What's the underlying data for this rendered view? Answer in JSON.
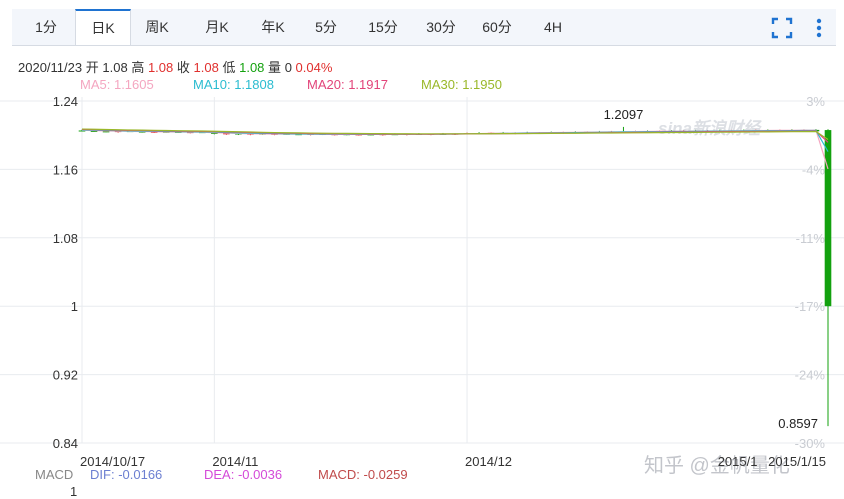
{
  "tabs": [
    {
      "label": "1分",
      "active": false
    },
    {
      "label": "日K",
      "active": true
    },
    {
      "label": "周K",
      "active": false
    },
    {
      "label": "月K",
      "active": false
    },
    {
      "label": "年K",
      "active": false
    },
    {
      "label": "5分",
      "active": false
    },
    {
      "label": "15分",
      "active": false
    },
    {
      "label": "30分",
      "active": false
    },
    {
      "label": "60分",
      "active": false
    },
    {
      "label": "4H",
      "active": false
    }
  ],
  "toolbar": {
    "fullscreen_icon": "fullscreen-icon",
    "more_icon": "vertical-dots-icon"
  },
  "info": {
    "date": "2020/11/23",
    "open_label": "开",
    "open": "1.08",
    "high_label": "高",
    "high": "1.08",
    "close_label": "收",
    "close": "1.08",
    "low_label": "低",
    "low": "1.08",
    "volume_label": "量",
    "volume": "0",
    "change": "0.04%"
  },
  "ma": [
    {
      "label": "MA5:",
      "value": "1.1605",
      "color": "#f4a6c0"
    },
    {
      "label": "MA10:",
      "value": "1.1808",
      "color": "#2bbcd0"
    },
    {
      "label": "MA20:",
      "value": "1.1917",
      "color": "#e2447a"
    },
    {
      "label": "MA30:",
      "value": "1.1950",
      "color": "#9ab82a"
    }
  ],
  "macd": {
    "title": "MACD",
    "dif_label": "DIF:",
    "dif": "-0.0166",
    "dif_color": "#6c7fd1",
    "dea_label": "DEA:",
    "dea": "-0.0036",
    "dea_color": "#d44ad8",
    "macd_label": "MACD:",
    "macd": "-0.0259",
    "macd_color": "#c04b4b",
    "axis_top": "1"
  },
  "colors": {
    "up": "#e0302e",
    "down": "#13a10e",
    "grid": "#e8ebef",
    "accent": "#1f73d1"
  },
  "watermark": {
    "logo": "sina新浪财经",
    "credit": "知乎 @金帆量化"
  },
  "chart_data": {
    "type": "candlestick",
    "ylim": [
      0.84,
      1.24
    ],
    "y_ticks": [
      "1.24",
      "1.16",
      "1.08",
      "1",
      "0.92",
      "0.84"
    ],
    "y_tick_values": [
      1.24,
      1.16,
      1.08,
      1.0,
      0.92,
      0.84
    ],
    "pct_ticks": [
      "3%",
      "-4%",
      "-11%",
      "-17%",
      "-24%",
      "-30%"
    ],
    "x_ticks": [
      {
        "label": "2014/10/17",
        "index": 0
      },
      {
        "label": "2014/11",
        "index": 11
      },
      {
        "label": "2014/12",
        "index": 32
      },
      {
        "label": "2015/1",
        "index": 53
      },
      {
        "label": "2015/1/15",
        "index": 61
      }
    ],
    "annotations": [
      {
        "text": "1.2097",
        "index": 45,
        "value": 1.2097
      },
      {
        "text": "0.8597",
        "index": 62,
        "value": 0.8597
      }
    ],
    "candles": [
      {
        "o": 1.2055,
        "h": 1.2065,
        "l": 1.2045,
        "c": 1.205
      },
      {
        "o": 1.205,
        "h": 1.206,
        "l": 1.204,
        "c": 1.2045
      },
      {
        "o": 1.2045,
        "h": 1.2055,
        "l": 1.2035,
        "c": 1.204
      },
      {
        "o": 1.204,
        "h": 1.2052,
        "l": 1.203,
        "c": 1.2048
      },
      {
        "o": 1.2048,
        "h": 1.2058,
        "l": 1.2038,
        "c": 1.2042
      },
      {
        "o": 1.2042,
        "h": 1.205,
        "l": 1.203,
        "c": 1.2035
      },
      {
        "o": 1.2035,
        "h": 1.2046,
        "l": 1.2026,
        "c": 1.204
      },
      {
        "o": 1.204,
        "h": 1.205,
        "l": 1.203,
        "c": 1.2038
      },
      {
        "o": 1.2038,
        "h": 1.2048,
        "l": 1.2028,
        "c": 1.2032
      },
      {
        "o": 1.2032,
        "h": 1.2042,
        "l": 1.2022,
        "c": 1.2036
      },
      {
        "o": 1.2036,
        "h": 1.2046,
        "l": 1.2026,
        "c": 1.203
      },
      {
        "o": 1.203,
        "h": 1.204,
        "l": 1.201,
        "c": 1.2015
      },
      {
        "o": 1.2015,
        "h": 1.2028,
        "l": 1.2005,
        "c": 1.2022
      },
      {
        "o": 1.2022,
        "h": 1.2032,
        "l": 1.2002,
        "c": 1.2008
      },
      {
        "o": 1.2008,
        "h": 1.202,
        "l": 1.2,
        "c": 1.2018
      },
      {
        "o": 1.2018,
        "h": 1.2028,
        "l": 1.2005,
        "c": 1.201
      },
      {
        "o": 1.201,
        "h": 1.2022,
        "l": 1.2,
        "c": 1.2016
      },
      {
        "o": 1.2016,
        "h": 1.2026,
        "l": 1.2006,
        "c": 1.2012
      },
      {
        "o": 1.2012,
        "h": 1.2022,
        "l": 1.2002,
        "c": 1.2006
      },
      {
        "o": 1.2006,
        "h": 1.2018,
        "l": 1.1998,
        "c": 1.2014
      },
      {
        "o": 1.2014,
        "h": 1.2024,
        "l": 1.2002,
        "c": 1.2008
      },
      {
        "o": 1.2008,
        "h": 1.2018,
        "l": 1.1998,
        "c": 1.2012
      },
      {
        "o": 1.2012,
        "h": 1.2022,
        "l": 1.2,
        "c": 1.2004
      },
      {
        "o": 1.2004,
        "h": 1.2016,
        "l": 1.1996,
        "c": 1.201
      },
      {
        "o": 1.201,
        "h": 1.202,
        "l": 1.2,
        "c": 1.2006
      },
      {
        "o": 1.2006,
        "h": 1.2016,
        "l": 1.1996,
        "c": 1.2012
      },
      {
        "o": 1.2012,
        "h": 1.2022,
        "l": 1.2002,
        "c": 1.2008
      },
      {
        "o": 1.2008,
        "h": 1.2018,
        "l": 1.1998,
        "c": 1.2014
      },
      {
        "o": 1.2014,
        "h": 1.2024,
        "l": 1.2004,
        "c": 1.201
      },
      {
        "o": 1.201,
        "h": 1.202,
        "l": 1.2,
        "c": 1.2016
      },
      {
        "o": 1.2016,
        "h": 1.2026,
        "l": 1.2006,
        "c": 1.2012
      },
      {
        "o": 1.2012,
        "h": 1.2022,
        "l": 1.2002,
        "c": 1.2018
      },
      {
        "o": 1.2018,
        "h": 1.203,
        "l": 1.2008,
        "c": 1.2025
      },
      {
        "o": 1.2025,
        "h": 1.2035,
        "l": 1.2015,
        "c": 1.202
      },
      {
        "o": 1.202,
        "h": 1.2032,
        "l": 1.201,
        "c": 1.2028
      },
      {
        "o": 1.2028,
        "h": 1.2038,
        "l": 1.2018,
        "c": 1.2022
      },
      {
        "o": 1.2022,
        "h": 1.2034,
        "l": 1.2012,
        "c": 1.203
      },
      {
        "o": 1.203,
        "h": 1.204,
        "l": 1.202,
        "c": 1.2026
      },
      {
        "o": 1.2026,
        "h": 1.2036,
        "l": 1.2016,
        "c": 1.2032
      },
      {
        "o": 1.2032,
        "h": 1.2042,
        "l": 1.2022,
        "c": 1.2028
      },
      {
        "o": 1.2028,
        "h": 1.204,
        "l": 1.2018,
        "c": 1.2036
      },
      {
        "o": 1.2036,
        "h": 1.2046,
        "l": 1.2026,
        "c": 1.2032
      },
      {
        "o": 1.2032,
        "h": 1.2044,
        "l": 1.2022,
        "c": 1.204
      },
      {
        "o": 1.204,
        "h": 1.205,
        "l": 1.203,
        "c": 1.2036
      },
      {
        "o": 1.2036,
        "h": 1.205,
        "l": 1.2026,
        "c": 1.2044
      },
      {
        "o": 1.2044,
        "h": 1.2097,
        "l": 1.203,
        "c": 1.204
      },
      {
        "o": 1.204,
        "h": 1.2052,
        "l": 1.203,
        "c": 1.2046
      },
      {
        "o": 1.2046,
        "h": 1.2056,
        "l": 1.2036,
        "c": 1.2042
      },
      {
        "o": 1.2042,
        "h": 1.2054,
        "l": 1.2032,
        "c": 1.205
      },
      {
        "o": 1.205,
        "h": 1.206,
        "l": 1.204,
        "c": 1.2046
      },
      {
        "o": 1.2046,
        "h": 1.2058,
        "l": 1.2036,
        "c": 1.2052
      },
      {
        "o": 1.2052,
        "h": 1.2062,
        "l": 1.2042,
        "c": 1.2048
      },
      {
        "o": 1.2048,
        "h": 1.206,
        "l": 1.2038,
        "c": 1.2054
      },
      {
        "o": 1.2054,
        "h": 1.2064,
        "l": 1.2044,
        "c": 1.205
      },
      {
        "o": 1.205,
        "h": 1.2062,
        "l": 1.204,
        "c": 1.2056
      },
      {
        "o": 1.2056,
        "h": 1.2066,
        "l": 1.2046,
        "c": 1.2052
      },
      {
        "o": 1.2052,
        "h": 1.2064,
        "l": 1.2042,
        "c": 1.2058
      },
      {
        "o": 1.2058,
        "h": 1.2068,
        "l": 1.2048,
        "c": 1.2054
      },
      {
        "o": 1.2054,
        "h": 1.2066,
        "l": 1.2044,
        "c": 1.206
      },
      {
        "o": 1.206,
        "h": 1.207,
        "l": 1.205,
        "c": 1.2056
      },
      {
        "o": 1.2056,
        "h": 1.2068,
        "l": 1.2046,
        "c": 1.2062
      },
      {
        "o": 1.2062,
        "h": 1.2072,
        "l": 1.204,
        "c": 1.2045
      },
      {
        "o": 1.206,
        "h": 1.207,
        "l": 0.8597,
        "c": 1.0
      }
    ],
    "series": [
      {
        "name": "MA5",
        "values": [
          1.2058,
          1.2054,
          1.205,
          1.2047,
          1.2045,
          1.2043,
          1.2041,
          1.2039,
          1.2037,
          1.2036,
          1.2034,
          1.203,
          1.2025,
          1.202,
          1.2017,
          1.2015,
          1.2014,
          1.2013,
          1.2012,
          1.2011,
          1.2011,
          1.201,
          1.201,
          1.201,
          1.201,
          1.201,
          1.2011,
          1.2011,
          1.2012,
          1.2013,
          1.2014,
          1.2015,
          1.2017,
          1.2019,
          1.2021,
          1.2023,
          1.2025,
          1.2027,
          1.2029,
          1.203,
          1.2032,
          1.2034,
          1.2035,
          1.2037,
          1.2039,
          1.204,
          1.2042,
          1.2043,
          1.2045,
          1.2046,
          1.2047,
          1.2049,
          1.205,
          1.2051,
          1.2052,
          1.2053,
          1.2054,
          1.2055,
          1.2056,
          1.2057,
          1.2058,
          1.2058,
          1.1605
        ]
      },
      {
        "name": "MA10",
        "values": [
          1.2062,
          1.2059,
          1.2056,
          1.2053,
          1.205,
          1.2048,
          1.2046,
          1.2044,
          1.2042,
          1.204,
          1.2038,
          1.2035,
          1.2031,
          1.2027,
          1.2024,
          1.2021,
          1.2019,
          1.2017,
          1.2015,
          1.2014,
          1.2013,
          1.2012,
          1.2012,
          1.2011,
          1.2011,
          1.2011,
          1.2011,
          1.2011,
          1.2012,
          1.2012,
          1.2013,
          1.2014,
          1.2015,
          1.2017,
          1.2018,
          1.202,
          1.2022,
          1.2024,
          1.2026,
          1.2027,
          1.2029,
          1.203,
          1.2032,
          1.2034,
          1.2035,
          1.2037,
          1.2038,
          1.204,
          1.2041,
          1.2043,
          1.2044,
          1.2045,
          1.2046,
          1.2047,
          1.2048,
          1.205,
          1.2051,
          1.2052,
          1.2053,
          1.2054,
          1.2055,
          1.2055,
          1.1808
        ]
      },
      {
        "name": "MA20",
        "values": [
          1.2068,
          1.2065,
          1.2062,
          1.2059,
          1.2056,
          1.2054,
          1.2052,
          1.205,
          1.2048,
          1.2046,
          1.2044,
          1.2041,
          1.2038,
          1.2035,
          1.2032,
          1.2029,
          1.2026,
          1.2024,
          1.2022,
          1.202,
          1.2018,
          1.2017,
          1.2016,
          1.2015,
          1.2014,
          1.2013,
          1.2013,
          1.2013,
          1.2013,
          1.2013,
          1.2014,
          1.2014,
          1.2015,
          1.2016,
          1.2017,
          1.2018,
          1.2019,
          1.202,
          1.2022,
          1.2023,
          1.2024,
          1.2025,
          1.2027,
          1.2028,
          1.2029,
          1.2031,
          1.2032,
          1.2033,
          1.2035,
          1.2036,
          1.2037,
          1.2038,
          1.204,
          1.2041,
          1.2042,
          1.2043,
          1.2044,
          1.2045,
          1.2046,
          1.2047,
          1.2048,
          1.2049,
          1.1917
        ]
      },
      {
        "name": "MA30",
        "values": [
          1.2072,
          1.207,
          1.2067,
          1.2064,
          1.2061,
          1.2059,
          1.2057,
          1.2055,
          1.2053,
          1.2051,
          1.2049,
          1.2046,
          1.2043,
          1.204,
          1.2037,
          1.2034,
          1.2031,
          1.2029,
          1.2027,
          1.2025,
          1.2023,
          1.2022,
          1.2021,
          1.202,
          1.2019,
          1.2018,
          1.2017,
          1.2017,
          1.2016,
          1.2016,
          1.2016,
          1.2016,
          1.2016,
          1.2017,
          1.2017,
          1.2018,
          1.2018,
          1.2019,
          1.202,
          1.2021,
          1.2022,
          1.2023,
          1.2024,
          1.2025,
          1.2026,
          1.2027,
          1.2028,
          1.2029,
          1.203,
          1.2031,
          1.2032,
          1.2033,
          1.2034,
          1.2035,
          1.2036,
          1.2037,
          1.2038,
          1.2039,
          1.204,
          1.2041,
          1.2042,
          1.2043,
          1.195
        ]
      }
    ]
  }
}
